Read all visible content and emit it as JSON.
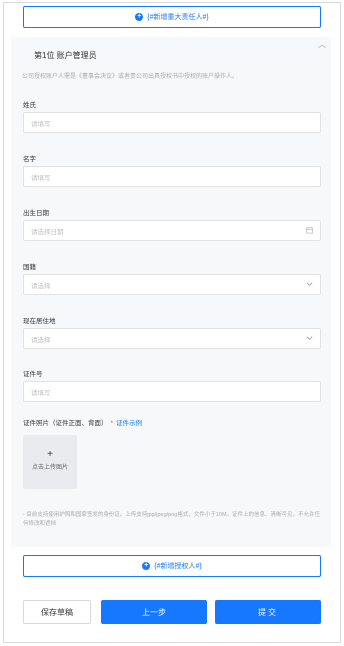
{
  "top_add_button": {
    "icon": "plus-circle-icon",
    "label": "{#新增重大责任人#}"
  },
  "card": {
    "collapse_icon": "chevron-up-icon",
    "title": "第1位 账户管理员",
    "description": "公司授权账户人需是《董事会决议》或者贵公司出具授权书中授权的账户操作人。"
  },
  "fields": {
    "last_name": {
      "label": "姓氏",
      "placeholder": "请填写"
    },
    "first_name": {
      "label": "名字",
      "placeholder": "请填写"
    },
    "birth_date": {
      "label": "出生日期",
      "placeholder": "请选择日期",
      "icon": "calendar-icon"
    },
    "nationality": {
      "label": "国籍",
      "placeholder": "请选择",
      "icon": "chevron-down-icon"
    },
    "residence": {
      "label": "现在居住地",
      "placeholder": "请选择",
      "icon": "chevron-down-icon"
    },
    "id_number": {
      "label": "证件号",
      "placeholder": "请填写"
    }
  },
  "upload": {
    "label": "证件照片（证件正面、背面）",
    "required_mark": "*",
    "example_link": "证件示例",
    "box_plus": "+",
    "box_text": "点击上传图片",
    "hint": "- 目前支持使用护照和国家签发的身份证。上传支持jpg/jpeg/png格式，文件小于10M。证件上的信息、清晰可见，不允许任何修改和遮挡"
  },
  "bottom_add_button": {
    "icon": "plus-circle-icon",
    "label": "{#新增授权人#}"
  },
  "footer": {
    "save_draft": "保存草稿",
    "previous": "上一步",
    "submit": "提交"
  },
  "colors": {
    "accent": "#1677ff",
    "required": "#e34d59"
  }
}
